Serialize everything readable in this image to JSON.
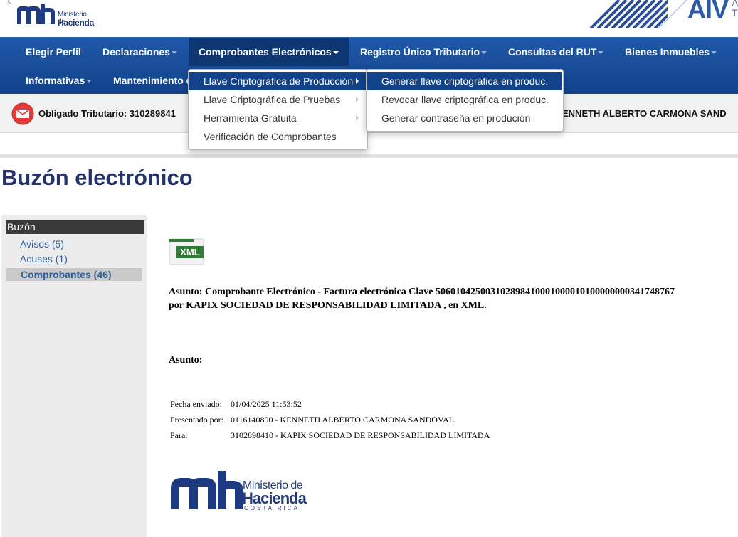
{
  "header": {
    "logo_mark": "mh",
    "logo_line1": "Ministerio de",
    "logo_line2": "Hacienda",
    "right_brand": "AIV",
    "right_side_1": "A",
    "right_side_2": "T",
    "corner_glyph": "s"
  },
  "nav": {
    "items": [
      {
        "label": "Elegir Perfil",
        "has_caret": false
      },
      {
        "label": "Declaraciones",
        "has_caret": true
      },
      {
        "label": "Comprobantes Electrónicos",
        "has_caret": true,
        "active": true
      },
      {
        "label": "Registro Único Tributario",
        "has_caret": true
      },
      {
        "label": "Consultas del RUT",
        "has_caret": true
      },
      {
        "label": "Bienes Inmuebles",
        "has_caret": true
      },
      {
        "label": "Informativas",
        "has_caret": true
      },
      {
        "label": "Mantenimiento d",
        "has_caret": false
      }
    ]
  },
  "menu": {
    "level1": [
      {
        "label": "Llave Criptográfica de Producción",
        "highlighted": true,
        "submenu": true
      },
      {
        "label": "Llave Criptográfica de Pruebas",
        "submenu": true
      },
      {
        "label": "Herramienta Gratuita",
        "submenu": true
      },
      {
        "label": "Verificación de Comprobantes",
        "submenu": false
      }
    ],
    "level2": [
      {
        "label": "Generar llave criptográfica en produc.",
        "highlighted": true
      },
      {
        "label": "Revocar llave criptográfica en produc."
      },
      {
        "label": "Generar contraseña en produción"
      }
    ]
  },
  "taxpayer": {
    "label": "Obligado Tributario: 310289841",
    "name": "ENNETH ALBERTO CARMONA SAND"
  },
  "page": {
    "title": "Buzón electrónico"
  },
  "sidebar": {
    "header": "Buzón",
    "links": [
      {
        "label": "Avisos (5)"
      },
      {
        "label": "Acuses (1)"
      },
      {
        "label": "Comprobantes (46)",
        "active": true
      }
    ]
  },
  "message": {
    "attachment_label": "XML",
    "subject_line1": "Asunto: Comprobante Electrónico - Factura electrónica Clave 506010425003102898410001000010100000000341748767",
    "subject_line2": "por KAPIX SOCIEDAD DE RESPONSABILIDAD LIMITADA , en XML.",
    "subject2": "Asunto:",
    "fields": [
      {
        "label": "Fecha enviado:",
        "value": "01/04/2025 11:53:52"
      },
      {
        "label": "Presentado por:",
        "value": "0116140890 - KENNETH ALBERTO CARMONA SANDOVAL"
      },
      {
        "label": "Para:",
        "value": "3102898410 - KAPIX SOCIEDAD DE RESPONSABILIDAD LIMITADA"
      }
    ],
    "footer_logo_line1": "Ministerio de",
    "footer_logo_line2": "Hacienda",
    "footer_logo_line3": "COSTA RICA"
  },
  "colors": {
    "nav_bg": "#1f59a8",
    "nav_active": "#0d3673",
    "menu_highlight": "#12428a",
    "title": "#25336c",
    "link": "#2f5f9a",
    "mail_icon": "#e23a3a"
  }
}
